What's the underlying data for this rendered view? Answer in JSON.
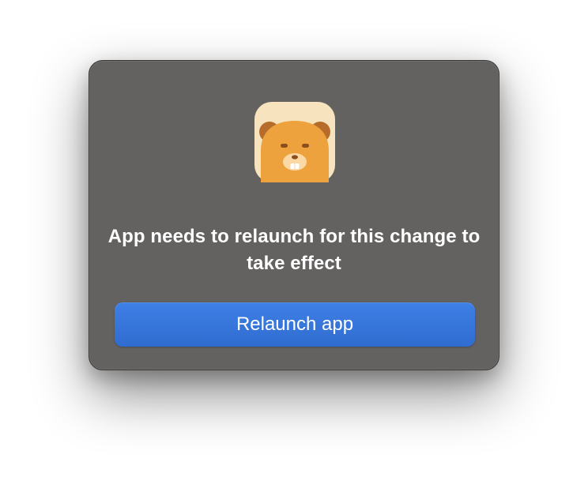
{
  "dialog": {
    "message": "App needs to relaunch for this change to take effect",
    "button_label": "Relaunch app",
    "app_icon": "beaver-app-icon"
  },
  "colors": {
    "panel": "#646260",
    "button": "#3574dc",
    "text": "#ffffff"
  }
}
